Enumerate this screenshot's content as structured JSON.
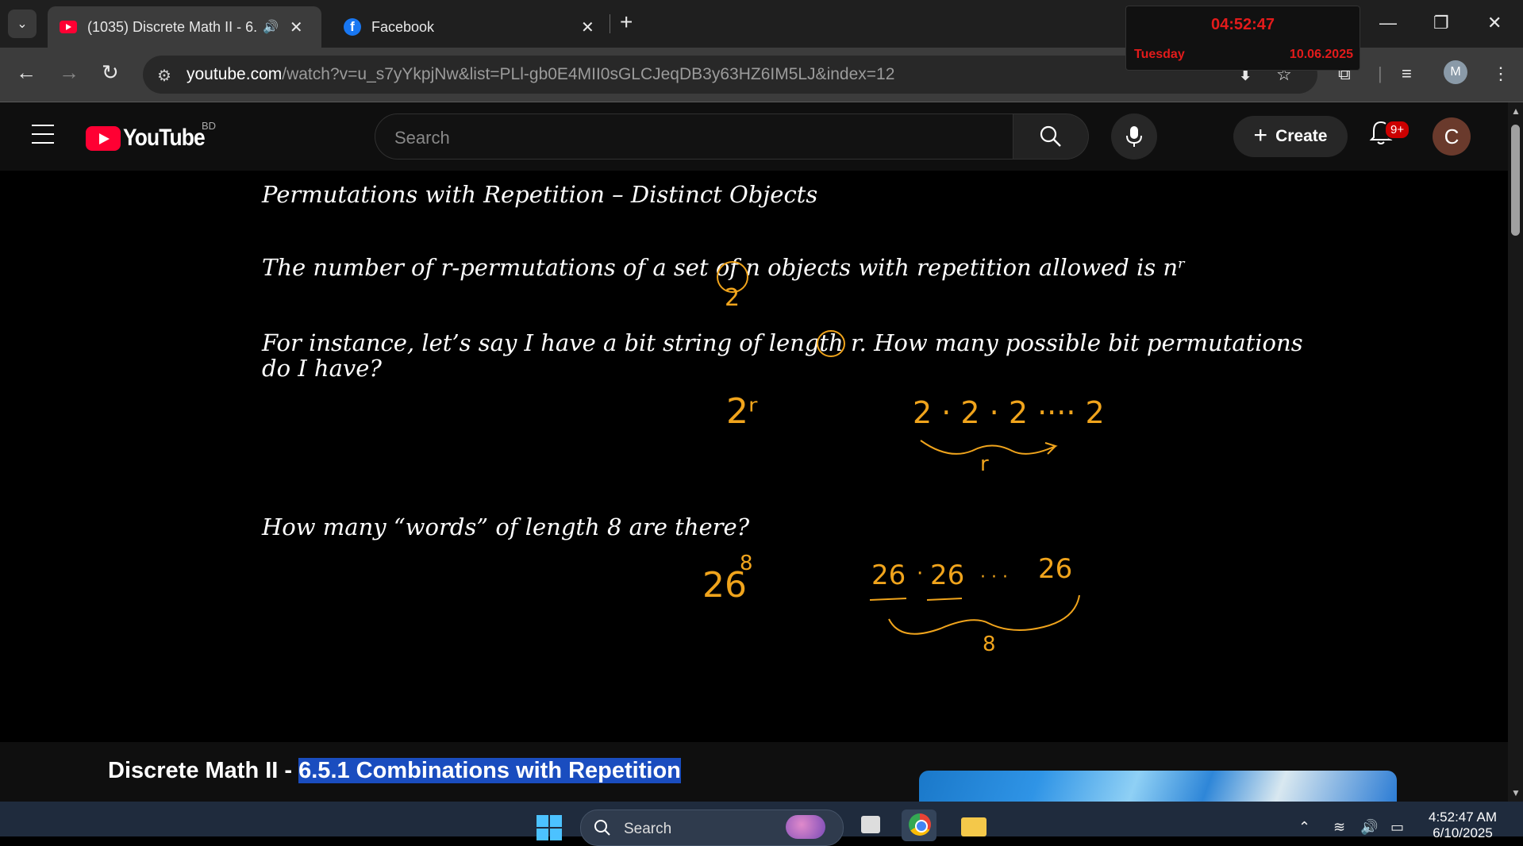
{
  "browser": {
    "tabs": [
      {
        "title": "(1035) Discrete Math II - 6.5.1 Combinations with Repetition",
        "active": true
      },
      {
        "title": "Facebook",
        "active": false
      }
    ],
    "url_domain": "youtube.com",
    "url_path": "/watch?v=u_s7yYkpjNw&list=PLl-gb0E4MII0sGLCJeqDB3y63HZ6IM5LJ&index=12",
    "profile_initial": "M"
  },
  "clock_widget": {
    "time": "04:52:47",
    "day": "Tuesday",
    "date": "10.06.2025"
  },
  "youtube": {
    "logo_text": "YouTube",
    "country_code": "BD",
    "search_placeholder": "Search",
    "create_label": "Create",
    "notification_count": "9+",
    "avatar_initial": "C"
  },
  "video_frame": {
    "section_title": "Permutations with Repetition – Distinct Objects",
    "statement": "The number of r-permutations of a set of n objects with repetition allowed is nʳ",
    "example_line1": "For instance, let’s say I have a bit string of length r. How many possible bit permutations",
    "example_line2": "do I have?",
    "question2": "How many “words” of length 8 are there?",
    "ink": {
      "n_value": "2",
      "answer1": "2ʳ",
      "product1": "2 · 2 · 2 ···· 2",
      "brace1_label": "r",
      "answer2_base": "26",
      "answer2_exp": "8",
      "product2_a": "26",
      "product2_b": "26",
      "product2_dots": "· · ·",
      "product2_c": "26",
      "brace2_label": "8"
    }
  },
  "video_title": {
    "prefix": "Discrete Math II - ",
    "highlighted": "6.5.1 Combinations with Repetition"
  },
  "taskbar": {
    "search_label": "Search",
    "time": "4:52:47 AM",
    "date": "6/10/2025"
  }
}
